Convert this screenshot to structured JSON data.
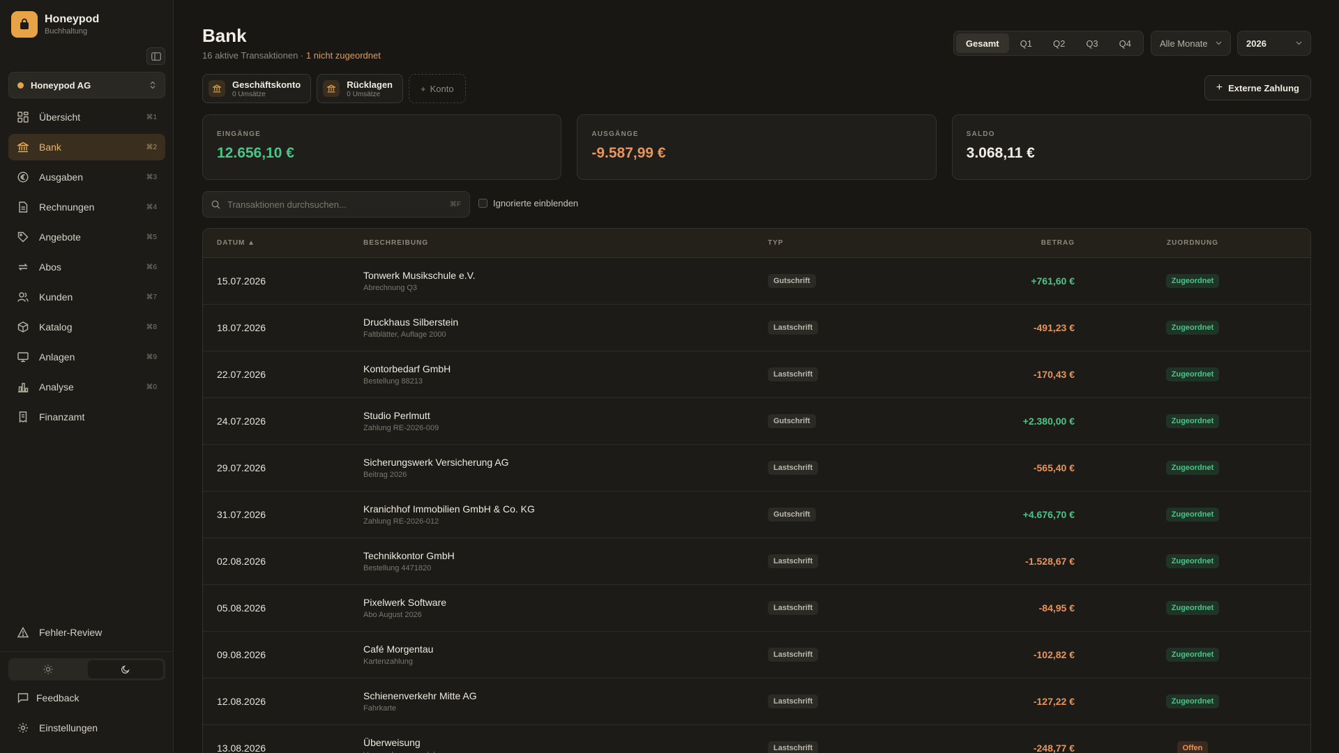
{
  "brand": {
    "name": "Honeypod",
    "sub": "Buchhaltung"
  },
  "company": {
    "name": "Honeypod AG"
  },
  "sidebar": {
    "items": [
      {
        "label": "Übersicht",
        "kbd": "⌘1",
        "icon": "grid-icon",
        "active": false
      },
      {
        "label": "Bank",
        "kbd": "⌘2",
        "icon": "bank-icon",
        "active": true
      },
      {
        "label": "Ausgaben",
        "kbd": "⌘3",
        "icon": "euro-icon",
        "active": false
      },
      {
        "label": "Rechnungen",
        "kbd": "⌘4",
        "icon": "file-icon",
        "active": false
      },
      {
        "label": "Angebote",
        "kbd": "⌘5",
        "icon": "tag-icon",
        "active": false
      },
      {
        "label": "Abos",
        "kbd": "⌘6",
        "icon": "repeat-icon",
        "active": false
      },
      {
        "label": "Kunden",
        "kbd": "⌘7",
        "icon": "users-icon",
        "active": false
      },
      {
        "label": "Katalog",
        "kbd": "⌘8",
        "icon": "box-icon",
        "active": false
      },
      {
        "label": "Anlagen",
        "kbd": "⌘9",
        "icon": "monitor-icon",
        "active": false
      },
      {
        "label": "Analyse",
        "kbd": "⌘0",
        "icon": "chart-icon",
        "active": false
      },
      {
        "label": "Finanzamt",
        "kbd": "",
        "icon": "receipt-icon",
        "active": false
      }
    ],
    "error_review": "Fehler-Review",
    "feedback": "Feedback",
    "settings": "Einstellungen"
  },
  "header": {
    "title": "Bank",
    "sub_count": "16 aktive Transaktionen",
    "sub_sep": " · ",
    "sub_warn": "1 nicht zugeordnet",
    "periods": [
      "Gesamt",
      "Q1",
      "Q2",
      "Q3",
      "Q4"
    ],
    "selected_period": "Gesamt",
    "month": "Alle Monate",
    "year": "2026"
  },
  "accounts": [
    {
      "name": "Geschäftskonto",
      "sub": "0 Umsätze"
    },
    {
      "name": "Rücklagen",
      "sub": "0 Umsätze"
    }
  ],
  "add_account": "Konto",
  "external_payment": "Externe Zahlung",
  "cards": [
    {
      "label": "EINGÄNGE",
      "value": "12.656,10 €",
      "tone": "pos"
    },
    {
      "label": "AUSGÄNGE",
      "value": "-9.587,99 €",
      "tone": "neg"
    },
    {
      "label": "SALDO",
      "value": "3.068,11 €",
      "tone": "neutral"
    }
  ],
  "search": {
    "placeholder": "Transaktionen durchsuchen...",
    "kbd": "⌘F"
  },
  "ignored_label": "Ignorierte einblenden",
  "table": {
    "headers": {
      "date": "DATUM ▲",
      "desc": "BESCHREIBUNG",
      "type": "TYP",
      "amount": "BETRAG",
      "assign": "ZUORDNUNG"
    },
    "rows": [
      {
        "date": "15.07.2026",
        "title": "Tonwerk Musikschule e.V.",
        "sub": "Abrechnung Q3",
        "type": "Gutschrift",
        "amount": "+761,60 €",
        "status": "Zugeordnet"
      },
      {
        "date": "18.07.2026",
        "title": "Druckhaus Silberstein",
        "sub": "Faltblätter, Auflage 2000",
        "type": "Lastschrift",
        "amount": "-491,23 €",
        "status": "Zugeordnet"
      },
      {
        "date": "22.07.2026",
        "title": "Kontorbedarf GmbH",
        "sub": "Bestellung 88213",
        "type": "Lastschrift",
        "amount": "-170,43 €",
        "status": "Zugeordnet"
      },
      {
        "date": "24.07.2026",
        "title": "Studio Perlmutt",
        "sub": "Zahlung RE-2026-009",
        "type": "Gutschrift",
        "amount": "+2.380,00 €",
        "status": "Zugeordnet"
      },
      {
        "date": "29.07.2026",
        "title": "Sicherungswerk Versicherung AG",
        "sub": "Beitrag 2026",
        "type": "Lastschrift",
        "amount": "-565,40 €",
        "status": "Zugeordnet"
      },
      {
        "date": "31.07.2026",
        "title": "Kranichhof Immobilien GmbH & Co. KG",
        "sub": "Zahlung RE-2026-012",
        "type": "Gutschrift",
        "amount": "+4.676,70 €",
        "status": "Zugeordnet"
      },
      {
        "date": "02.08.2026",
        "title": "Technikkontor GmbH",
        "sub": "Bestellung 4471820",
        "type": "Lastschrift",
        "amount": "-1.528,67 €",
        "status": "Zugeordnet"
      },
      {
        "date": "05.08.2026",
        "title": "Pixelwerk Software",
        "sub": "Abo August 2026",
        "type": "Lastschrift",
        "amount": "-84,95 €",
        "status": "Zugeordnet"
      },
      {
        "date": "09.08.2026",
        "title": "Café Morgentau",
        "sub": "Kartenzahlung",
        "type": "Lastschrift",
        "amount": "-102,82 €",
        "status": "Zugeordnet"
      },
      {
        "date": "12.08.2026",
        "title": "Schienenverkehr Mitte AG",
        "sub": "Fahrkarte",
        "type": "Lastschrift",
        "amount": "-127,22 €",
        "status": "Zugeordnet"
      },
      {
        "date": "13.08.2026",
        "title": "Überweisung",
        "sub": "Verwendungszweck leer",
        "type": "Lastschrift",
        "amount": "-248,77 €",
        "status": "Offen"
      }
    ]
  }
}
